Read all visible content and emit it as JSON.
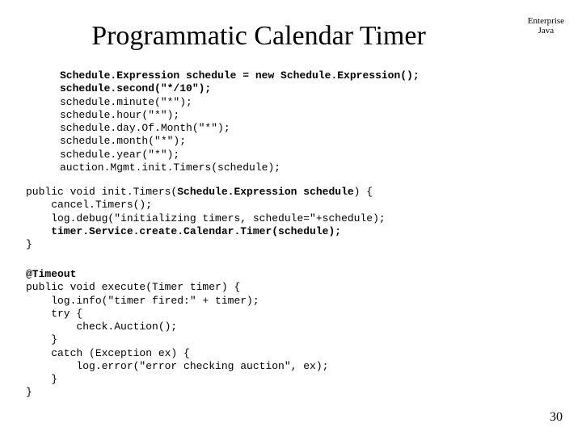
{
  "corner": {
    "line1": "Enterprise",
    "line2": "Java"
  },
  "title": "Programmatic Calendar Timer",
  "code1": {
    "l1_bold": "Schedule.Expression schedule = new Schedule.Expression();",
    "l2_bold": "schedule.second(\"*/10\");",
    "l3": "schedule.minute(\"*\");",
    "l4": "schedule.hour(\"*\");",
    "l5": "schedule.day.Of.Month(\"*\");",
    "l6": "schedule.month(\"*\");",
    "l7": "schedule.year(\"*\");",
    "l8": "auction.Mgmt.init.Timers(schedule);"
  },
  "code2": {
    "l1a": "public void init.Timers(",
    "l1b_bold": "Schedule.Expression schedule",
    "l1c": ") {",
    "l2": "    cancel.Timers();",
    "l3": "    log.debug(\"initializing timers, schedule=\"+schedule);",
    "l4_bold": "    timer.Service.create.Calendar.Timer(schedule);",
    "l5": "}"
  },
  "code3": {
    "l1_bold": "@Timeout",
    "l2": "public void execute(Timer timer) {",
    "l3": "    log.info(\"timer fired:\" + timer);",
    "l4": "    try {",
    "l5": "        check.Auction();",
    "l6": "    }",
    "l7": "    catch (Exception ex) {",
    "l8": "        log.error(\"error checking auction\", ex);",
    "l9": "    }",
    "l10": "}"
  },
  "page": "30"
}
